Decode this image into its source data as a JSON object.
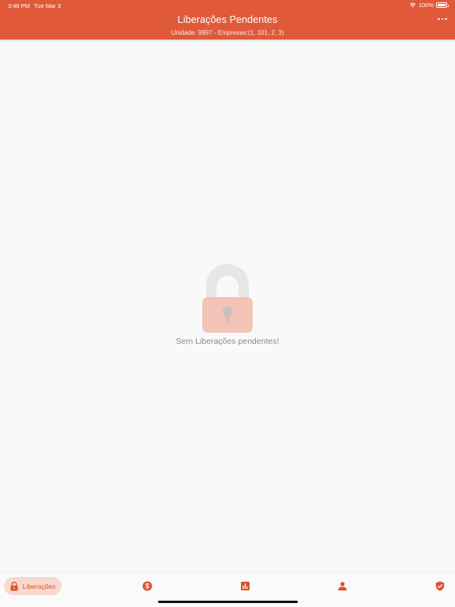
{
  "status_bar": {
    "time": "3:46 PM",
    "date": "Tue Mar 3",
    "battery": "100%"
  },
  "header": {
    "title": "Liberações Pendentes",
    "subtitle": "Unidade: 9997 - Empresas:(1, 101, 2, 3)",
    "more_icon": "more-horizontal-icon"
  },
  "empty_state": {
    "icon": "lock-open-icon",
    "message": "Sem Liberações pendentes!"
  },
  "tabs": [
    {
      "label": "Liberações",
      "icon": "lock-icon",
      "active": true
    },
    {
      "label": "",
      "icon": "dollar-circle-icon",
      "active": false
    },
    {
      "label": "",
      "icon": "bar-chart-icon",
      "active": false
    },
    {
      "label": "",
      "icon": "person-icon",
      "active": false
    },
    {
      "label": "",
      "icon": "shield-check-icon",
      "active": false
    }
  ],
  "colors": {
    "primary": "#e05a3a",
    "tab_active_bg": "#f7d9d0",
    "background": "#f9f9f9"
  }
}
